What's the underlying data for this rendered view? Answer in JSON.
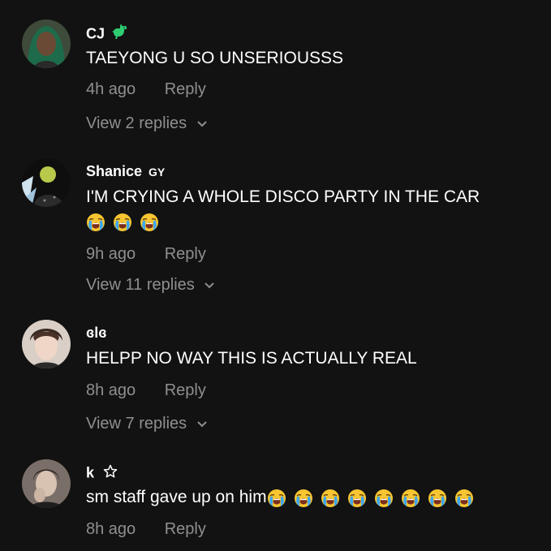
{
  "comments": [
    {
      "username": "CJ",
      "badge_icon": "dinosaur-icon",
      "text": "TAEYONG U SO UNSERIOUSSS",
      "time": "4h ago",
      "reply_label": "Reply",
      "view_replies": "View 2 replies"
    },
    {
      "username": "Shanice",
      "badge_text": "GY",
      "text": "I'M CRYING A WHOLE DISCO PARTY IN THE CAR",
      "emoji_icon": "loudly-crying-face-icon",
      "emoji_count": 3,
      "time": "9h ago",
      "reply_label": "Reply",
      "view_replies": "View 11 replies"
    },
    {
      "username": "ɞlɞ",
      "text": "HELPP NO WAY THIS IS ACTUALLY REAL",
      "time": "8h ago",
      "reply_label": "Reply",
      "view_replies": "View 7 replies"
    },
    {
      "username": "k",
      "badge_icon": "star-outline-icon",
      "text": "sm staff gave up on him",
      "emoji_icon": "loudly-crying-face-icon",
      "emoji_count": 8,
      "time": "8h ago",
      "reply_label": "Reply"
    }
  ],
  "colors": {
    "background": "#121212",
    "primary_text": "#ffffff",
    "secondary_text": "#8f8f8f",
    "dino_green": "#2ecc71"
  }
}
